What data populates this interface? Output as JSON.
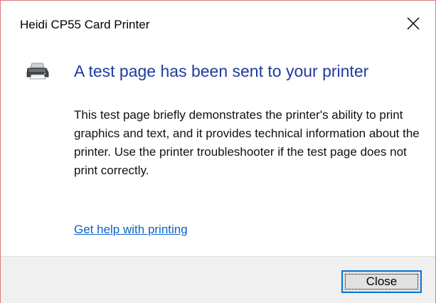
{
  "window": {
    "title": "Heidi CP55 Card Printer",
    "close_icon": "close-icon"
  },
  "content": {
    "icon": "printer-icon",
    "heading": "A test page has been sent to your printer",
    "body": "This test page briefly demonstrates the printer's ability to print graphics and text, and it provides technical information about the printer. Use the printer troubleshooter if the test page does not print correctly.",
    "help_link": "Get help with printing"
  },
  "footer": {
    "close_label": "Close"
  },
  "colors": {
    "heading": "#1f3c9e",
    "link": "#0a63c9",
    "window_border": "#d9777f",
    "footer_bg": "#f0f0f0",
    "button_focus_border": "#0a72d6"
  }
}
